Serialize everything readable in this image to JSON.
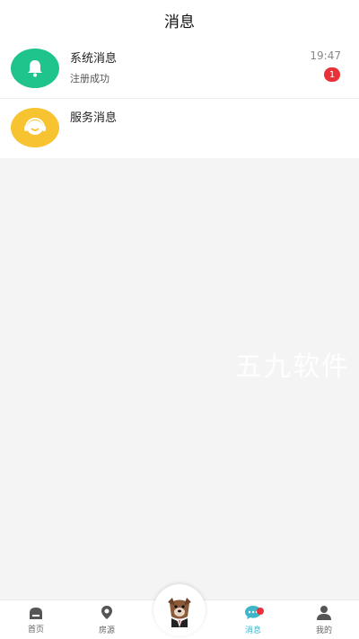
{
  "header": {
    "title": "消息"
  },
  "messages": [
    {
      "title": "系统消息",
      "subtitle": "注册成功",
      "time": "19:47",
      "badge": "1",
      "icon": "bell-icon",
      "color": "#1fc48c"
    },
    {
      "title": "服务消息",
      "subtitle": "",
      "time": "",
      "badge": "",
      "icon": "headset-icon",
      "color": "#f7c330"
    }
  ],
  "watermark": "五九软件",
  "tabbar": {
    "items": [
      {
        "label": "首页",
        "icon": "home-icon"
      },
      {
        "label": "房源",
        "icon": "location-pin-icon"
      },
      {
        "label": "消息",
        "icon": "chat-icon",
        "active": true,
        "dot": true
      },
      {
        "label": "我的",
        "icon": "person-icon"
      }
    ],
    "center_icon": "mascot-icon"
  },
  "colors": {
    "accent": "#3eb6c8",
    "badge": "#e8323a",
    "background": "#f4f4f4"
  }
}
